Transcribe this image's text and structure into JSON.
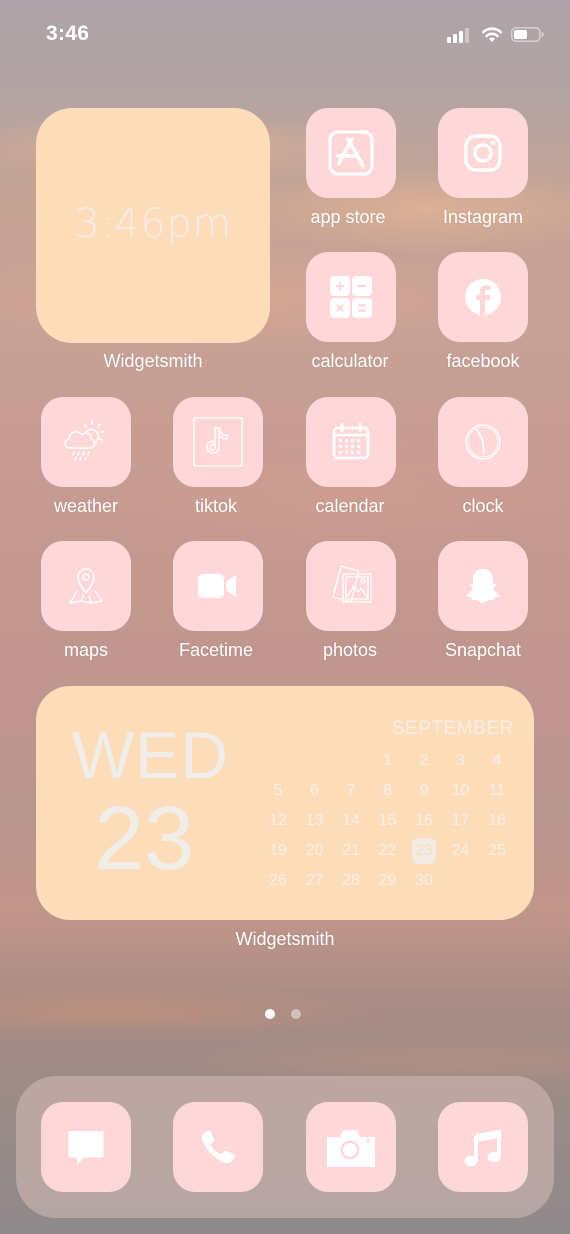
{
  "status_bar": {
    "time": "3:46",
    "icons": [
      "cellular-signal-icon",
      "wifi-icon",
      "battery-icon"
    ]
  },
  "colors": {
    "widget_bg": "#fddcba",
    "app_icon_bg": "#fed8d8",
    "glyph": "#ffffff",
    "label": "#ffffff"
  },
  "clock_widget": {
    "time_text": "3:46pm",
    "label": "Widgetsmith"
  },
  "apps": [
    {
      "label": "app store",
      "icon": "app-store-icon"
    },
    {
      "label": "Instagram",
      "icon": "instagram-icon"
    },
    {
      "label": "calculator",
      "icon": "calculator-icon"
    },
    {
      "label": "facebook",
      "icon": "facebook-icon"
    },
    {
      "label": "weather",
      "icon": "weather-icon"
    },
    {
      "label": "tiktok",
      "icon": "tiktok-icon"
    },
    {
      "label": "calendar",
      "icon": "calendar-icon"
    },
    {
      "label": "clock",
      "icon": "clock-icon"
    },
    {
      "label": "maps",
      "icon": "map-pin-icon"
    },
    {
      "label": "Facetime",
      "icon": "video-camera-icon"
    },
    {
      "label": "photos",
      "icon": "photos-icon"
    },
    {
      "label": "Snapchat",
      "icon": "snapchat-ghost-icon"
    }
  ],
  "calendar_widget": {
    "weekday": "WED",
    "day": "23",
    "month": "SEPTEMBER",
    "first_weekday_index": 2,
    "days_in_month": 30,
    "today": 23,
    "label": "Widgetsmith"
  },
  "page_indicator": {
    "pages": 2,
    "current": 1
  },
  "dock": [
    {
      "name": "messages",
      "icon": "message-bubble-icon"
    },
    {
      "name": "phone",
      "icon": "phone-icon"
    },
    {
      "name": "camera",
      "icon": "camera-icon"
    },
    {
      "name": "music",
      "icon": "music-note-icon"
    }
  ]
}
